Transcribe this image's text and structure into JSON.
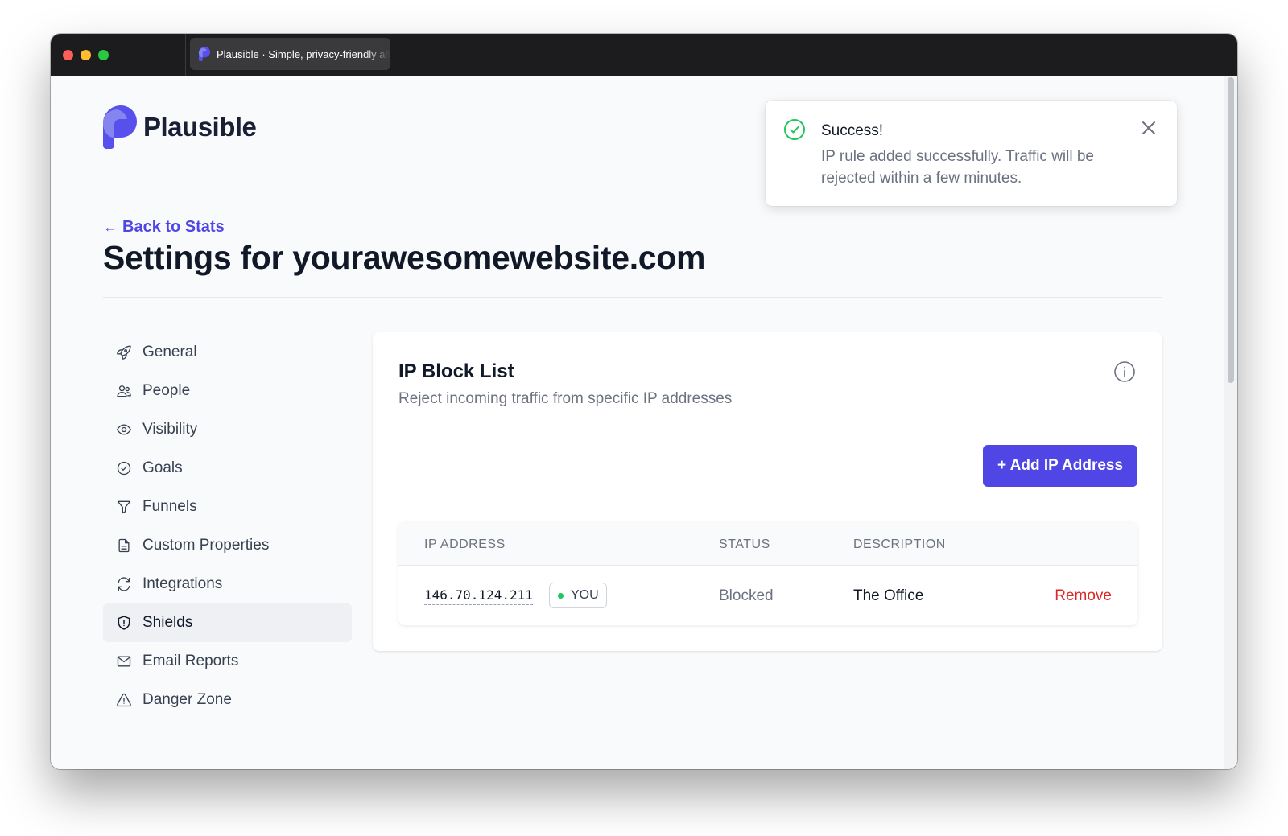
{
  "browser": {
    "tab_title": "Plausible · Simple, privacy-friendly alternative to Google Analytics"
  },
  "brand": {
    "name": "Plausible",
    "accent": "#4f46e5"
  },
  "header": {
    "back_label": "Back to Stats",
    "title": "Settings for yourawesomewebsite.com"
  },
  "sidebar": {
    "items": [
      {
        "label": "General",
        "icon": "rocket-icon"
      },
      {
        "label": "People",
        "icon": "users-icon"
      },
      {
        "label": "Visibility",
        "icon": "eye-icon"
      },
      {
        "label": "Goals",
        "icon": "check-circle-icon"
      },
      {
        "label": "Funnels",
        "icon": "funnel-icon"
      },
      {
        "label": "Custom Properties",
        "icon": "document-icon"
      },
      {
        "label": "Integrations",
        "icon": "refresh-icon"
      },
      {
        "label": "Shields",
        "icon": "shield-icon",
        "active": true
      },
      {
        "label": "Email Reports",
        "icon": "envelope-icon"
      },
      {
        "label": "Danger Zone",
        "icon": "warning-icon"
      }
    ]
  },
  "card": {
    "title": "IP Block List",
    "subtitle": "Reject incoming traffic from specific IP addresses",
    "add_button": "+ Add IP Address",
    "table": {
      "columns": [
        "IP ADDRESS",
        "STATUS",
        "DESCRIPTION"
      ],
      "rows": [
        {
          "ip": "146.70.124.211",
          "badge": "YOU",
          "status": "Blocked",
          "description": "The Office",
          "action": "Remove"
        }
      ]
    }
  },
  "toast": {
    "title": "Success!",
    "message": "IP rule added successfully. Traffic will be rejected within a few minutes."
  }
}
